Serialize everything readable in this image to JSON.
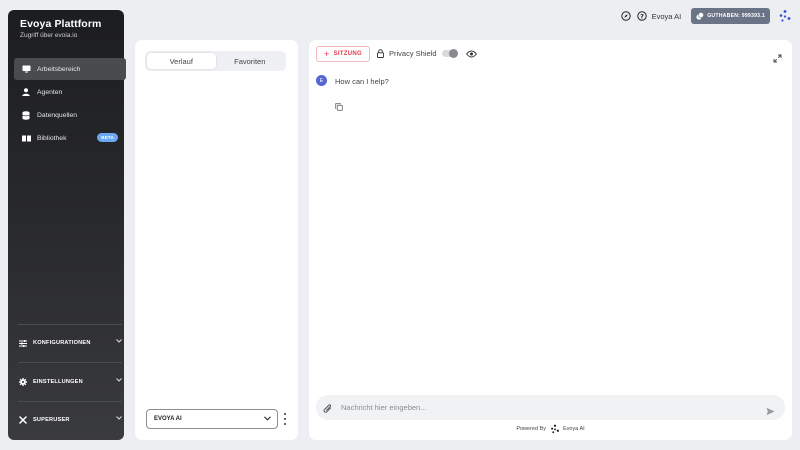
{
  "sidebar": {
    "brand_title": "Evoya Plattform",
    "brand_sub": "Zugriff über evoia.io",
    "items": [
      {
        "label": "Arbeitsbereich",
        "icon": "monitor-icon",
        "active": true
      },
      {
        "label": "Agenten",
        "icon": "user-icon"
      },
      {
        "label": "Datenquellen",
        "icon": "database-icon"
      },
      {
        "label": "Bibliothek",
        "icon": "book-icon",
        "badge": "BETA"
      }
    ],
    "sections": [
      {
        "label": "KONFIGURATIONEN",
        "icon": "sliders-icon"
      },
      {
        "label": "EINSTELLUNGEN",
        "icon": "gear-icon"
      },
      {
        "label": "SUPERUSER",
        "icon": "tools-icon"
      }
    ]
  },
  "history_panel": {
    "tabs": [
      "Verlauf",
      "Favoriten"
    ],
    "active_tab": 0,
    "model_select": "EVOYA AI"
  },
  "topbar": {
    "assistant_label": "Evoya AI",
    "credits_label": "GUTHABEN: 999393.1"
  },
  "chat": {
    "session_button": "SITZUNG",
    "privacy_label": "Privacy Shield",
    "avatar_letter": "E",
    "messages": [
      {
        "text": "How can I help?"
      }
    ],
    "input_placeholder": "Nachricht hier eingeben...",
    "powered_prefix": "Powered By",
    "powered_brand": "Evoya AI"
  },
  "colors": {
    "accent_red": "#e23b4c",
    "credits_bg": "#6b7387",
    "beta_badge": "#6aa8f2",
    "avatar": "#5567d6",
    "logo_blue": "#2f4fd8"
  }
}
